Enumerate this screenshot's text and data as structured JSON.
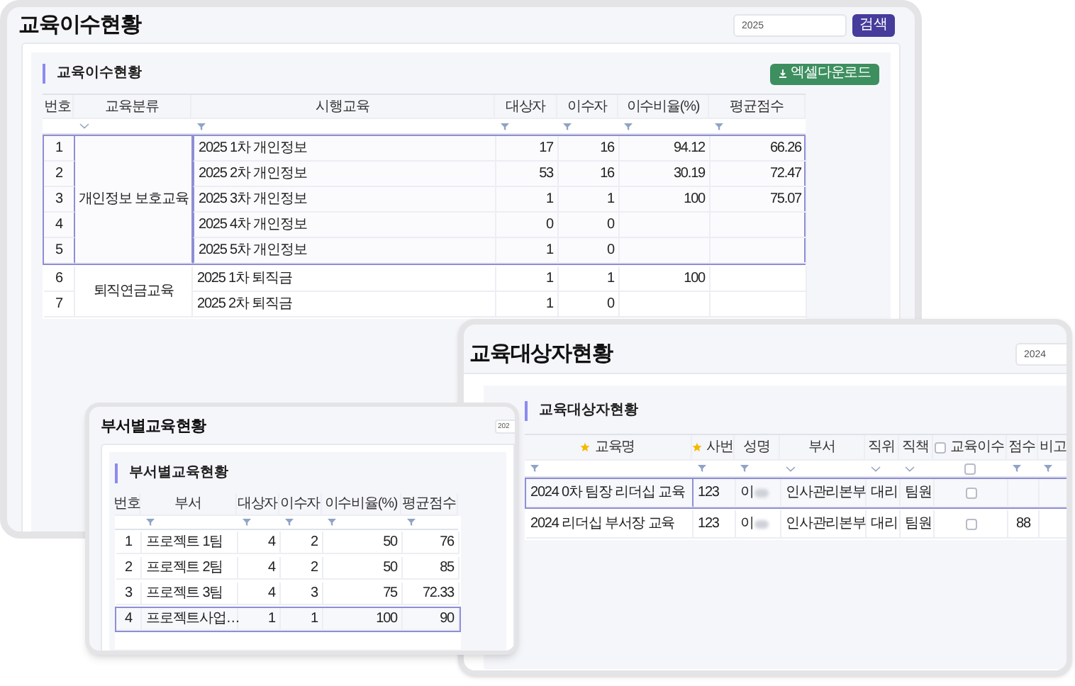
{
  "main": {
    "title": "교육이수현황",
    "search": {
      "value": "2025"
    },
    "search_button": "검색",
    "section_title": "교육이수현황",
    "excel_button": "엑셀다운로드",
    "columns": [
      {
        "label": "번호"
      },
      {
        "label": "교육분류"
      },
      {
        "label": "시행교육"
      },
      {
        "label": "대상자"
      },
      {
        "label": "이수자"
      },
      {
        "label": "이수비율(%)"
      },
      {
        "label": "평균점수"
      }
    ],
    "groups": [
      {
        "category": "개인정보 보호교육",
        "selected": true,
        "rows": [
          {
            "no": "1",
            "course": "2025 1차 개인정보",
            "targets": "17",
            "completed": "16",
            "rate": "94.12",
            "average": "66.26"
          },
          {
            "no": "2",
            "course": "2025 2차 개인정보",
            "targets": "53",
            "completed": "16",
            "rate": "30.19",
            "average": "72.47"
          },
          {
            "no": "3",
            "course": "2025 3차 개인정보",
            "targets": "1",
            "completed": "1",
            "rate": "100",
            "average": "75.07"
          },
          {
            "no": "4",
            "course": "2025 4차 개인정보",
            "targets": "0",
            "completed": "0"
          },
          {
            "no": "5",
            "course": "2025 5차 개인정보",
            "targets": "1",
            "completed": "0"
          }
        ]
      },
      {
        "category": "퇴직연금교육",
        "selected": false,
        "rows": [
          {
            "no": "6",
            "course": "2025 1차 퇴직금",
            "targets": "1",
            "completed": "1",
            "rate": "100"
          },
          {
            "no": "7",
            "course": "2025 2차 퇴직금",
            "targets": "1",
            "completed": "0"
          }
        ]
      }
    ]
  },
  "targets": {
    "title": "교육대상자현황",
    "search": {
      "value": "2024"
    },
    "section_title": "교육대상자현황",
    "columns": [
      {
        "label": "교육명",
        "required": true
      },
      {
        "label": "사번",
        "required": true
      },
      {
        "label": "성명",
        "required": false
      },
      {
        "label": "부서",
        "required": false
      },
      {
        "label": "직위",
        "required": false
      },
      {
        "label": "직책",
        "required": false
      },
      {
        "label": "교육이수",
        "required": false,
        "checked": false,
        "filter_checked": false
      },
      {
        "label": "점수",
        "required": false
      },
      {
        "label": "비고",
        "required": false
      }
    ],
    "rows": [
      {
        "selected": true,
        "course": "2024 0차 팀장 리더십 교육",
        "employee_no": "123",
        "name": "이",
        "department": "인사관리본부",
        "position": "대리",
        "role": "팀원",
        "completed": false
      },
      {
        "selected": false,
        "course": "2024 리더십 부서장 교육",
        "employee_no": "123",
        "name": "이",
        "department": "인사관리본부",
        "position": "대리",
        "role": "팀원",
        "completed": false,
        "score": "88"
      }
    ]
  },
  "departments": {
    "title": "부서별교육현황",
    "search": {
      "value": "202"
    },
    "section_title": "부서별교육현황",
    "columns": [
      {
        "label": "번호"
      },
      {
        "label": "부서"
      },
      {
        "label": "대상자"
      },
      {
        "label": "이수자"
      },
      {
        "label": "이수비율(%)"
      },
      {
        "label": "평균점수"
      }
    ],
    "rows": [
      {
        "selected": false,
        "no": "1",
        "department": "프로젝트 1팀",
        "targets": "4",
        "completed": "2",
        "rate": "50",
        "average": "76"
      },
      {
        "selected": false,
        "no": "2",
        "department": "프로젝트 2팀",
        "targets": "4",
        "completed": "2",
        "rate": "50",
        "average": "85"
      },
      {
        "selected": false,
        "no": "3",
        "department": "프로젝트 3팀",
        "targets": "4",
        "completed": "3",
        "rate": "75",
        "average": "72.33"
      },
      {
        "selected": true,
        "no": "4",
        "department": "프로젝트사업…",
        "targets": "1",
        "completed": "1",
        "rate": "100",
        "average": "90"
      }
    ]
  }
}
